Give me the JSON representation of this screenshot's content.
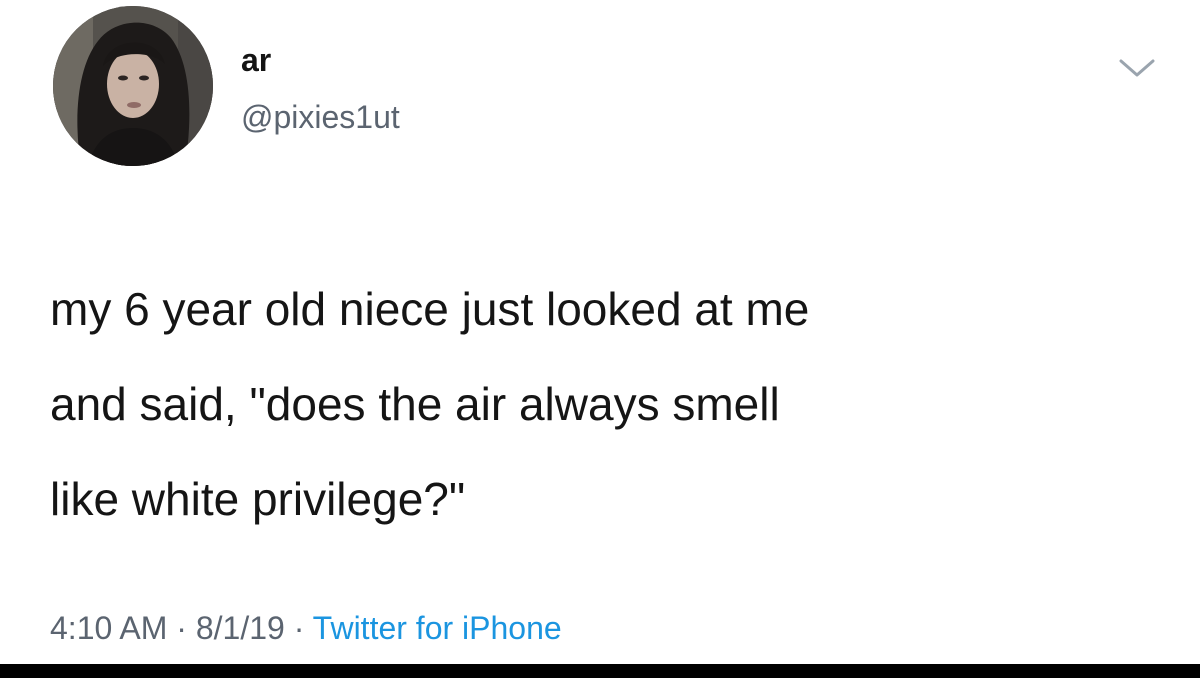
{
  "author": {
    "display_name": "ar",
    "handle": "@pixies1ut"
  },
  "tweet": {
    "text_lines": [
      "my 6 year old niece just looked at me",
      "and said, \"does the air always smell",
      "like white privilege?\""
    ],
    "time": "4:10 AM",
    "separator_1": " · ",
    "date": "8/1/19",
    "separator_2": " · ",
    "source": "Twitter for iPhone"
  },
  "icons": {
    "menu": "chevron-down-icon",
    "avatar": "profile-photo"
  },
  "colors": {
    "text": "#151515",
    "muted": "#5b6470",
    "link": "#1b95e0",
    "background": "#ffffff"
  }
}
